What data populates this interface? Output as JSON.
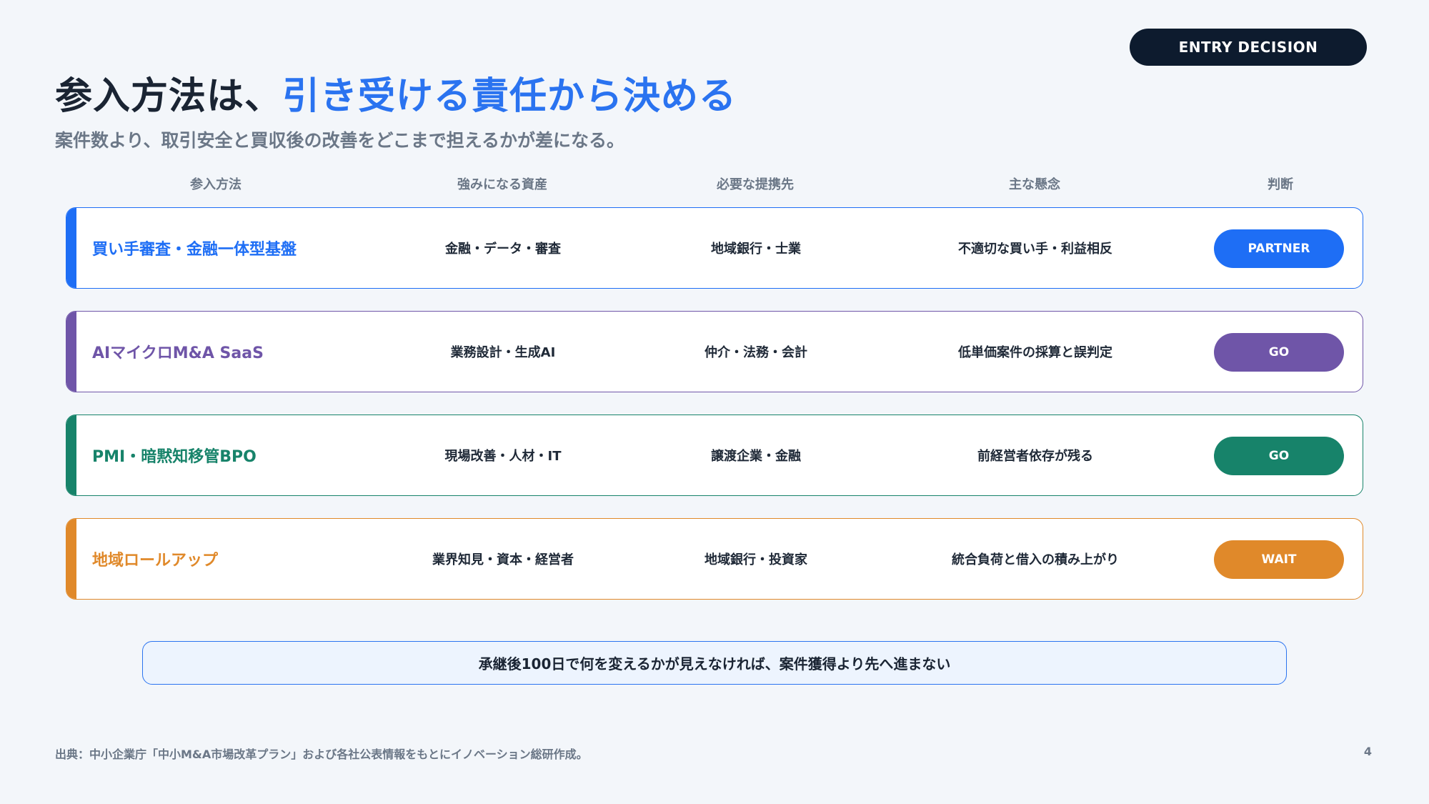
{
  "badge": "ENTRY DECISION",
  "title": {
    "main": "参入方法は、",
    "accent": "引き受ける責任から決める"
  },
  "subtitle": "案件数より、取引安全と買収後の改善をどこまで担えるかが差になる。",
  "columns": [
    "参入方法",
    "強みになる資産",
    "必要な提携先",
    "主な懸念",
    "判断"
  ],
  "rows": [
    {
      "method": "買い手審査・金融一体型基盤",
      "assets": "金融・データ・審査",
      "partners": "地域銀行・士業",
      "concern": "不適切な買い手・利益相反",
      "decision": "PARTNER",
      "color": "#1e6ef5"
    },
    {
      "method": "AIマイクロM&A SaaS",
      "assets": "業務設計・生成AI",
      "partners": "仲介・法務・会計",
      "concern": "低単価案件の採算と誤判定",
      "decision": "GO",
      "color": "#6f55a8"
    },
    {
      "method": "PMI・暗黙知移管BPO",
      "assets": "現場改善・人材・IT",
      "partners": "譲渡企業・金融",
      "concern": "前経営者依存が残る",
      "decision": "GO",
      "color": "#17836a"
    },
    {
      "method": "地域ロールアップ",
      "assets": "業界知見・資本・経営者",
      "partners": "地域銀行・投資家",
      "concern": "統合負荷と借入の積み上がり",
      "decision": "WAIT",
      "color": "#e0892a"
    }
  ],
  "callout": "承継後100日で何を変えるかが見えなければ、案件獲得より先へ進まない",
  "source": "出典：中小企業庁「中小M&A市場改革プラン」および各社公表情報をもとにイノベーション総研作成。",
  "page_number": "4"
}
